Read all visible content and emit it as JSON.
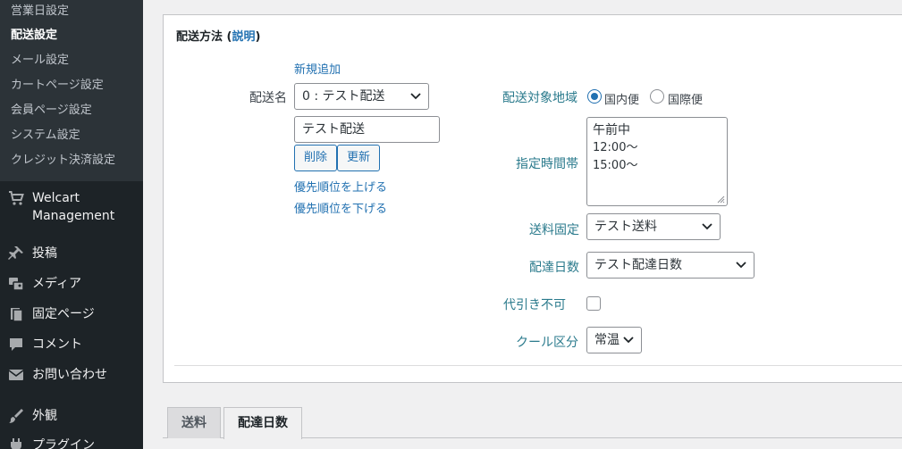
{
  "sidebar": {
    "submenu": [
      {
        "label": "営業日設定",
        "current": false
      },
      {
        "label": "配送設定",
        "current": true
      },
      {
        "label": "メール設定",
        "current": false
      },
      {
        "label": "カートページ設定",
        "current": false
      },
      {
        "label": "会員ページ設定",
        "current": false
      },
      {
        "label": "システム設定",
        "current": false
      },
      {
        "label": "クレジット決済設定",
        "current": false
      }
    ],
    "menu": {
      "welcart_line1": "Welcart",
      "welcart_line2": "Management",
      "posts": "投稿",
      "media": "メディア",
      "pages": "固定ページ",
      "comments": "コメント",
      "contact": "お問い合わせ",
      "appearance": "外観",
      "plugins": "プラグイン"
    }
  },
  "panel": {
    "title": "配送方法",
    "help_open": "(",
    "help_label": "説明",
    "help_close": ")",
    "add_new": "新規追加",
    "method_name_label": "配送名",
    "method_select_value": "0 : テスト配送",
    "method_name_input": "テスト配送",
    "delete_label": "削除",
    "update_label": "更新",
    "raise_priority": "優先順位を上げる",
    "lower_priority": "優先順位を下げる",
    "region_label": "配送対象地域",
    "region_domestic": "国内便",
    "region_international": "国際便",
    "timeslot_label": "指定時間帯",
    "timeslots": [
      "午前中",
      "12:00～",
      "15:00～"
    ],
    "fixed_fee_label": "送料固定",
    "fixed_fee_value": "テスト送料",
    "delivery_days_label": "配達日数",
    "delivery_days_value": "テスト配達日数",
    "cod_label": "代引き不可",
    "cool_label": "クール区分",
    "cool_value": "常温"
  },
  "tabs": [
    {
      "label": "送料",
      "active": false
    },
    {
      "label": "配達日数",
      "active": true
    }
  ]
}
